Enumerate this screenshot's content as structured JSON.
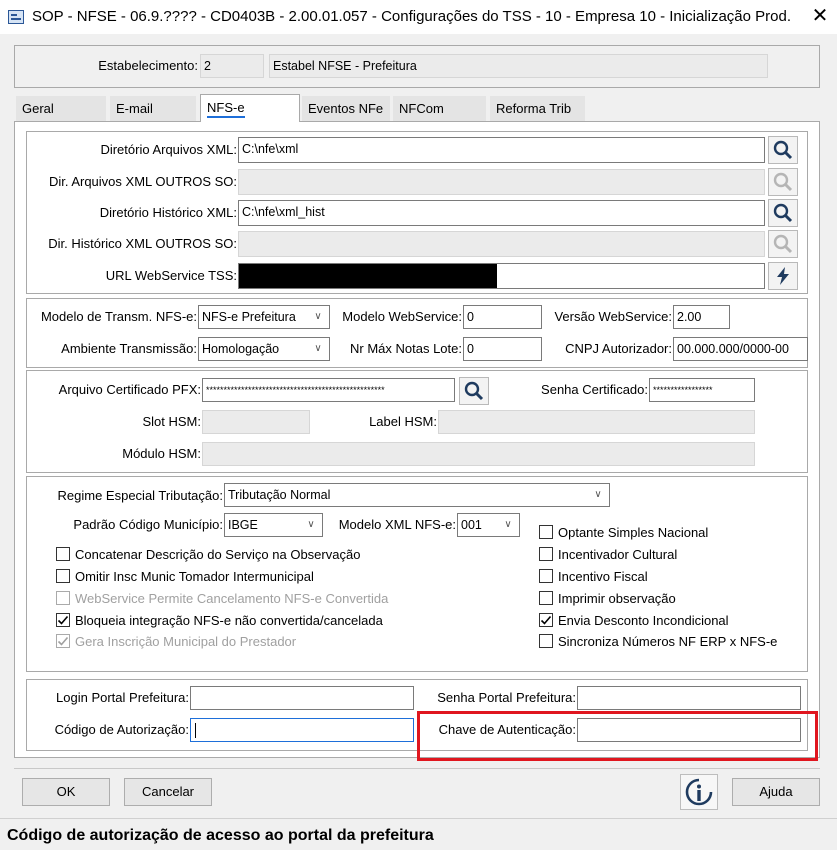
{
  "window": {
    "title": "SOP - NFSE - 06.9.???? - CD0403B - 2.00.01.057 - Configurações do TSS - 10 - Empresa 10 - Inicialização Prod..."
  },
  "estabelecimento": {
    "label": "Estabelecimento:",
    "code": "2",
    "name": "Estabel NFSE - Prefeitura"
  },
  "tabs": [
    "Geral",
    "E-mail",
    "NFS-e",
    "Eventos NFe",
    "NFCom",
    "Reforma Trib"
  ],
  "active_tab": "NFS-e",
  "paths": {
    "dir_xml_label": "Diretório Arquivos XML:",
    "dir_xml_value": "C:\\nfe\\xml",
    "dir_outros_label": "Dir. Arquivos XML OUTROS SO:",
    "dir_hist_label": "Diretório Histórico XML:",
    "dir_hist_value": "C:\\nfe\\xml_hist",
    "dir_hist_outros_label": "Dir. Histórico XML OUTROS SO:",
    "url_label": "URL WebService TSS:"
  },
  "transmissao": {
    "modelo_label": "Modelo de Transm. NFS-e:",
    "modelo_value": "NFS-e Prefeitura",
    "modelo_ws_label": "Modelo WebService:",
    "modelo_ws_value": "0",
    "versao_ws_label": "Versão WebService:",
    "versao_ws_value": "2.00",
    "ambiente_label": "Ambiente Transmissão:",
    "ambiente_value": "Homologação",
    "nr_max_label": "Nr Máx Notas Lote:",
    "nr_max_value": "0",
    "cnpj_label": "CNPJ Autorizador:",
    "cnpj_value": "00.000.000/0000-00"
  },
  "certificado": {
    "arquivo_label": "Arquivo Certificado PFX:",
    "arquivo_value": "***************************************************",
    "senha_label": "Senha Certificado:",
    "senha_value": "*****************",
    "slot_label": "Slot HSM:",
    "label_hsm_label": "Label HSM:",
    "modulo_label": "Módulo HSM:"
  },
  "regime": {
    "regime_label": "Regime Especial Tributação:",
    "regime_value": "Tributação Normal",
    "padrao_label": "Padrão Código Município:",
    "padrao_value": "IBGE",
    "modelo_xml_label": "Modelo XML NFS-e:",
    "modelo_xml_value": "001"
  },
  "checkboxes_left": [
    {
      "label": "Concatenar Descrição do Serviço na Observação",
      "checked": false,
      "disabled": false
    },
    {
      "label": "Omitir Insc Munic Tomador Intermunicipal",
      "checked": false,
      "disabled": false
    },
    {
      "label": "WebService Permite Cancelamento NFS-e Convertida",
      "checked": false,
      "disabled": true
    },
    {
      "label": "Bloqueia integração NFS-e não convertida/cancelada",
      "checked": true,
      "disabled": false
    },
    {
      "label": "Gera Inscrição Municipal do Prestador",
      "checked": true,
      "disabled": true
    }
  ],
  "checkboxes_right": [
    {
      "label": "Optante Simples Nacional",
      "checked": false
    },
    {
      "label": "Incentivador Cultural",
      "checked": false
    },
    {
      "label": "Incentivo Fiscal",
      "checked": false
    },
    {
      "label": "Imprimir observação",
      "checked": false
    },
    {
      "label": "Envia Desconto Incondicional",
      "checked": true
    },
    {
      "label": "Sincroniza Números NF ERP x NFS-e",
      "checked": false
    }
  ],
  "portal": {
    "login_label": "Login Portal Prefeitura:",
    "senha_label": "Senha Portal Prefeitura:",
    "codigo_label": "Código de Autorização:",
    "chave_label": "Chave de Autenticação:"
  },
  "buttons": {
    "ok": "OK",
    "cancelar": "Cancelar",
    "ajuda": "Ajuda"
  },
  "status_bar": "Código de autorização de acesso ao portal da prefeitura",
  "colors": {
    "highlight": "#e0161f",
    "search_icon": "#1f3b5f"
  }
}
